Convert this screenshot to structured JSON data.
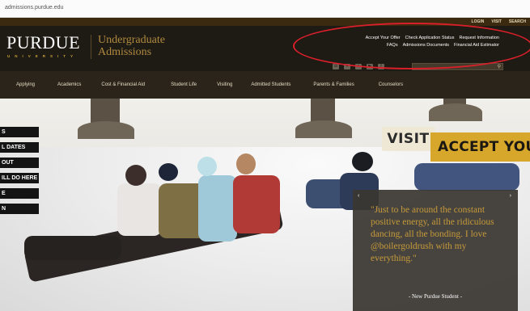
{
  "browser": {
    "url": "admissions.purdue.edu"
  },
  "utility_bar": [
    "LOGIN",
    "VISIT",
    "SEARCH"
  ],
  "header": {
    "logo_word": "PURDUE",
    "logo_sub": "UNIVERSITY",
    "unit_title": "Undergraduate Admissions"
  },
  "quick_links": {
    "row1": [
      "Accept Your Offer",
      "Check Application Status",
      "Request Information"
    ],
    "row2": [
      "FAQs",
      "Admissions Documents",
      "Financial Aid Estimator"
    ]
  },
  "social_icons": [
    "instagram-icon",
    "twitter-icon",
    "flickr-icon",
    "youtube-icon",
    "facebook-icon"
  ],
  "search": {
    "placeholder": "",
    "button_icon": "search-icon"
  },
  "nav": [
    "Applying",
    "Academics",
    "Cost & Financial Aid",
    "Student Life",
    "Visiting",
    "Admitted Students",
    "Parents & Families",
    "Counselors"
  ],
  "hero": {
    "left_tabs": [
      "S",
      "L DATES",
      "OUT",
      "ILL DO HERE",
      "E",
      "N"
    ],
    "visit_label": "VISIT",
    "accept_label": "ACCEPT YOUR OF",
    "quote": {
      "text": "\"Just to be around the constant positive energy, all the ridiculous dancing, all the bonding. I love @boilergoldrush with my everything.\"",
      "attribution": "- New Purdue Student -",
      "prev": "‹",
      "next": "›"
    }
  },
  "colors": {
    "gold": "#c69a3a",
    "accent_yellow": "#d6a72a",
    "header_bg": "#1e1a14",
    "annotation_red": "#d9202a"
  }
}
